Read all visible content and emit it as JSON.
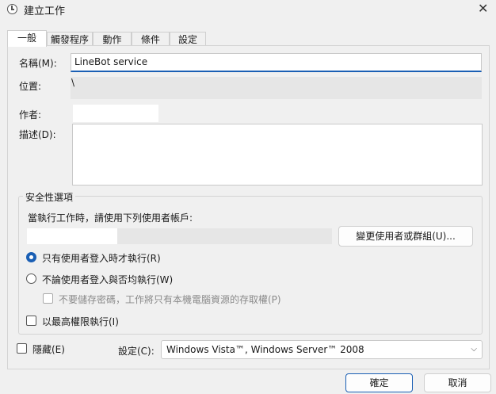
{
  "window": {
    "title": "建立工作"
  },
  "tabs": [
    {
      "label": "一般"
    },
    {
      "label": "觸發程序"
    },
    {
      "label": "動作"
    },
    {
      "label": "條件"
    },
    {
      "label": "設定"
    }
  ],
  "general": {
    "name_label": "名稱(M):",
    "name_value": "LineBot service",
    "location_label": "位置:",
    "location_value": "\\",
    "author_label": "作者:",
    "author_value": "",
    "description_label": "描述(D):",
    "description_value": ""
  },
  "security": {
    "group_title": "安全性選項",
    "run_as_text": "當執行工作時，請使用下列使用者帳戶:",
    "change_user_button": "變更使用者或群組(U)...",
    "radio_logged_on": "只有使用者登入時才執行(R)",
    "radio_whether": "不論使用者登入與否均執行(W)",
    "no_store_password": "不要儲存密碼，工作將只有本機電腦資源的存取權(P)",
    "highest_privileges": "以最高權限執行(I)"
  },
  "footer": {
    "hidden_label": "隱藏(E)",
    "config_label": "設定(C):",
    "config_value": "Windows Vista™, Windows Server™ 2008",
    "ok_button": "確定",
    "cancel_button": "取消"
  }
}
